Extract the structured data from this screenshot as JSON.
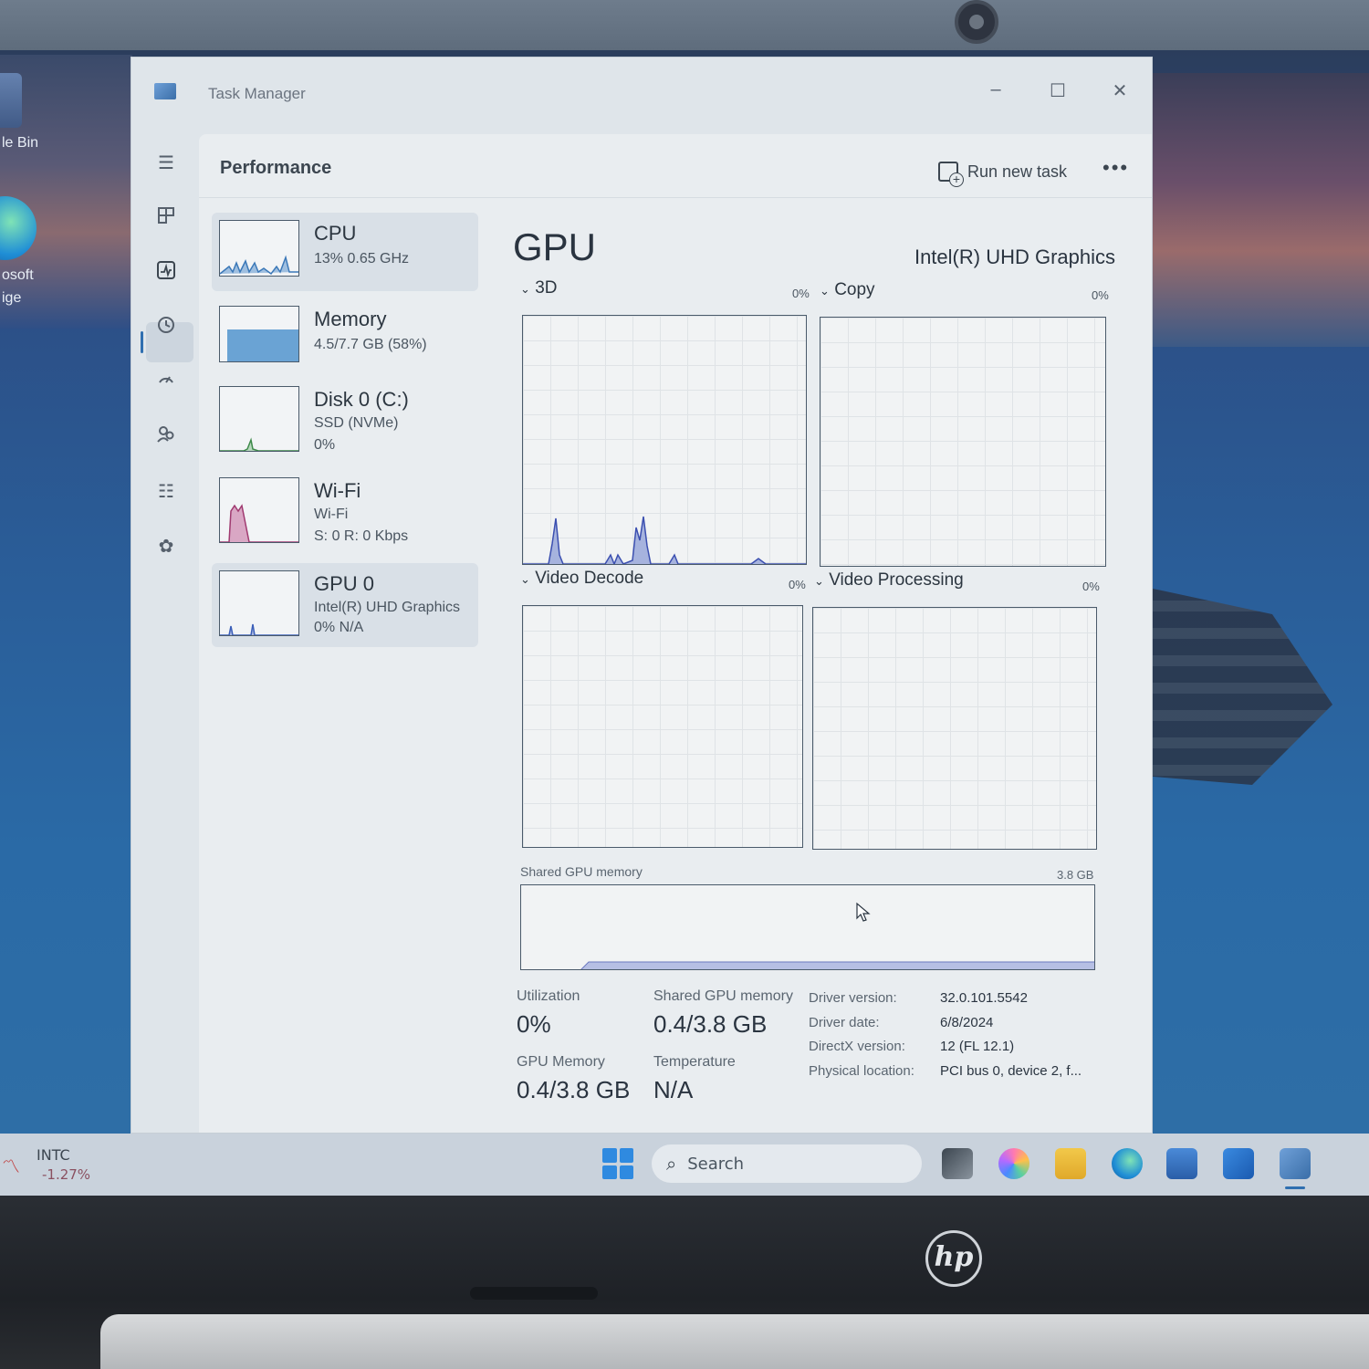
{
  "window": {
    "title": "Task Manager",
    "minimize": "–",
    "maximize": "☐",
    "close": "✕"
  },
  "desktop": {
    "icons": [
      {
        "label": "le Bin"
      },
      {
        "label": "osoft"
      },
      {
        "label": "ige"
      }
    ]
  },
  "header": {
    "page_title": "Performance",
    "run_new_task": "Run new task",
    "more": "•••"
  },
  "nav": {
    "items": [
      "menu-icon",
      "processes-icon",
      "performance-icon",
      "app-history-icon",
      "startup-icon",
      "users-icon",
      "details-icon",
      "services-icon"
    ],
    "settings": "settings-icon"
  },
  "devices": [
    {
      "name": "CPU",
      "line1": "13%  0.65 GHz",
      "line2": "",
      "active": true,
      "thumb_color": "#3b78b8"
    },
    {
      "name": "Memory",
      "line1": "4.5/7.7 GB (58%)",
      "line2": "",
      "active": false,
      "fill_pct": 58,
      "thumb_color": "#6aa3d4"
    },
    {
      "name": "Disk 0 (C:)",
      "line1": "SSD (NVMe)",
      "line2": "0%",
      "active": false,
      "thumb_color": "#3e8a4a"
    },
    {
      "name": "Wi-Fi",
      "line1": "Wi-Fi",
      "line2": "S: 0  R: 0 Kbps",
      "active": false,
      "thumb_color": "#c0508a"
    },
    {
      "name": "GPU 0",
      "line1": "Intel(R) UHD Graphics",
      "line2": "0%  N/A",
      "active": true,
      "thumb_color": "#3b5eb8"
    }
  ],
  "gpu": {
    "title": "GPU",
    "model": "Intel(R) UHD Graphics",
    "engines": [
      {
        "label": "3D",
        "pct": "0%"
      },
      {
        "label": "Copy",
        "pct": "0%"
      },
      {
        "label": "Video Decode",
        "pct": "0%"
      },
      {
        "label": "Video Processing",
        "pct": "0%"
      }
    ],
    "shared_memory": {
      "label": "Shared GPU memory",
      "max": "3.8 GB"
    },
    "stats": {
      "utilization_label": "Utilization",
      "utilization": "0%",
      "shared_label": "Shared GPU memory",
      "shared": "0.4/3.8 GB",
      "gpu_mem_label": "GPU Memory",
      "gpu_mem": "0.4/3.8 GB",
      "temp_label": "Temperature",
      "temp": "N/A"
    },
    "info": [
      {
        "key": "Driver version:",
        "value": "32.0.101.5542"
      },
      {
        "key": "Driver date:",
        "value": "6/8/2024"
      },
      {
        "key": "DirectX version:",
        "value": "12 (FL 12.1)"
      },
      {
        "key": "Physical location:",
        "value": "PCI bus 0, device 2, f..."
      }
    ]
  },
  "taskbar": {
    "ticker": {
      "name": "INTC",
      "change": "-1.27%"
    },
    "search_placeholder": "Search",
    "pinned": [
      "file-explorer-icon",
      "copilot-icon",
      "folder-icon",
      "edge-icon",
      "store-icon",
      "outlook-icon",
      "task-manager-icon"
    ]
  },
  "brand": {
    "logo": "hp"
  }
}
